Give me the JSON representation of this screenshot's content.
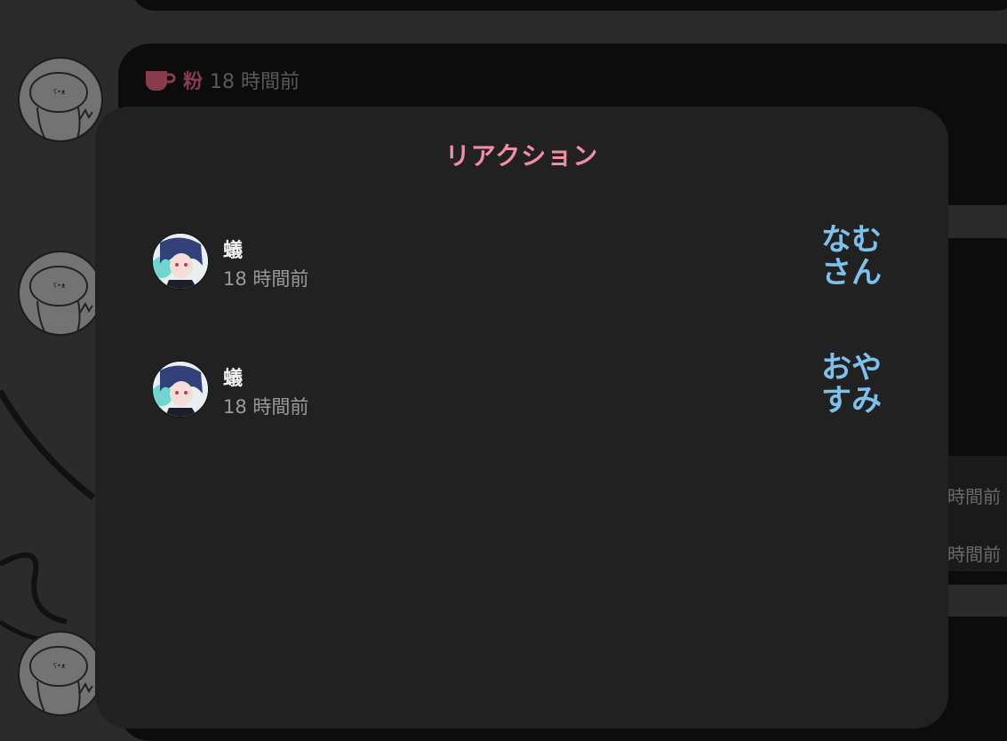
{
  "background": {
    "post": {
      "author": "粉",
      "time": "18 時間前"
    },
    "side_times": [
      "時間前",
      "時間前"
    ]
  },
  "modal": {
    "title": "リアクション",
    "reactions": [
      {
        "user": "蟻",
        "time": "18 時間前",
        "emoji_line1": "なむ",
        "emoji_line2": "さん"
      },
      {
        "user": "蟻",
        "time": "18 時間前",
        "emoji_line1": "おや",
        "emoji_line2": "すみ"
      }
    ]
  },
  "colors": {
    "title_accent": "#ef8ea5",
    "reaction_text": "#7cc1ec",
    "author_name": "#8a3b4d"
  },
  "icons": {
    "post_author_icon": "cup-icon"
  }
}
